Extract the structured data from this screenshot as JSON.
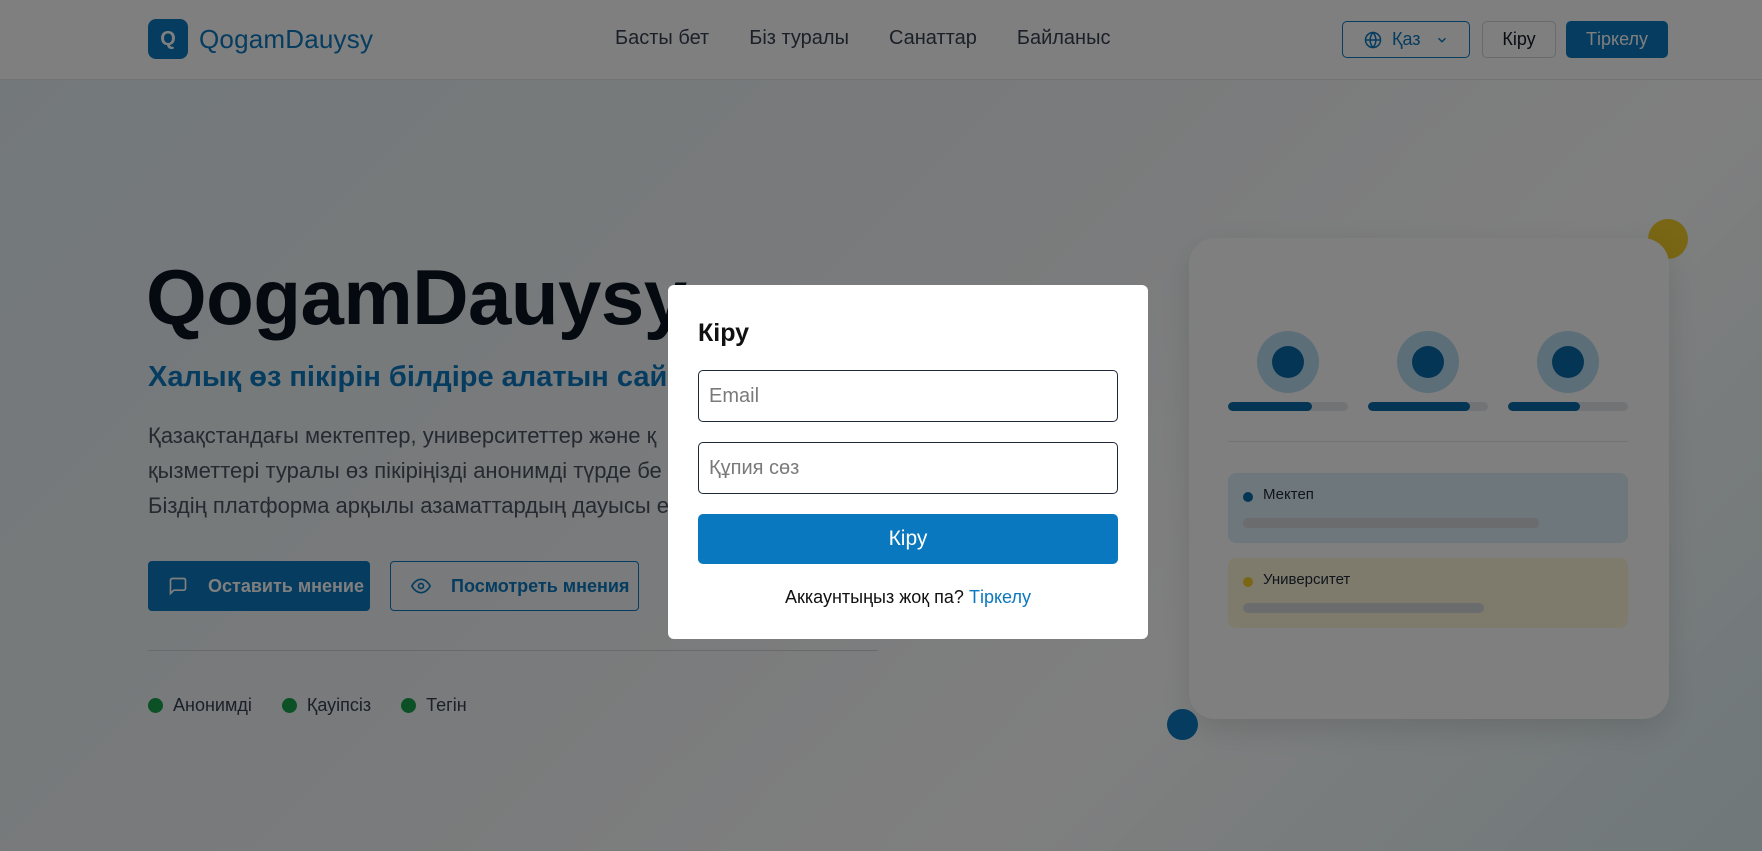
{
  "brand": {
    "logo_letter": "Q",
    "name": "QogamDauysy"
  },
  "nav": {
    "items": [
      {
        "label": "Басты бет"
      },
      {
        "label": "Біз туралы"
      },
      {
        "label": "Санаттар"
      },
      {
        "label": "Байланыс"
      }
    ]
  },
  "header": {
    "language": "Қаз",
    "login_label": "Кіру",
    "register_label": "Тіркелу"
  },
  "hero": {
    "title": "QogamDauysy",
    "subtitle": "Халық өз пікірін білдіре алатын сайт",
    "description_lines": [
      "Қазақстандағы мектептер, университеттер және қ",
      "қызметтері туралы өз пікіріңізді анонимді түрде бе",
      "Біздің платформа арқылы азаматтардың дауысы е"
    ],
    "primary_cta": "Оставить мнение",
    "secondary_cta": "Посмотреть мнения",
    "features": [
      {
        "label": "Анонимді"
      },
      {
        "label": "Қауіпсіз"
      },
      {
        "label": "Тегін"
      }
    ]
  },
  "illustration": {
    "stats": [
      {
        "fill": 0.7
      },
      {
        "fill": 0.85
      },
      {
        "fill": 0.6
      }
    ],
    "categories": [
      {
        "label": "Мектеп",
        "dot_color": "#0a6aa8",
        "bg_color": "#dceff7",
        "fill": 0.8
      },
      {
        "label": "Университет",
        "dot_color": "#f3ce2a",
        "bg_color": "#fcf6d9",
        "fill": 0.65
      }
    ]
  },
  "modal": {
    "title": "Кіру",
    "email_placeholder": "Email",
    "password_placeholder": "Құпия сөз",
    "submit_label": "Кіру",
    "footer_text": "Аккаунтыңыз жоқ па?",
    "footer_link": "Тіркелу"
  },
  "colors": {
    "accent": "#0a78be",
    "success": "#16a34a",
    "warning": "#f3ce2a"
  }
}
